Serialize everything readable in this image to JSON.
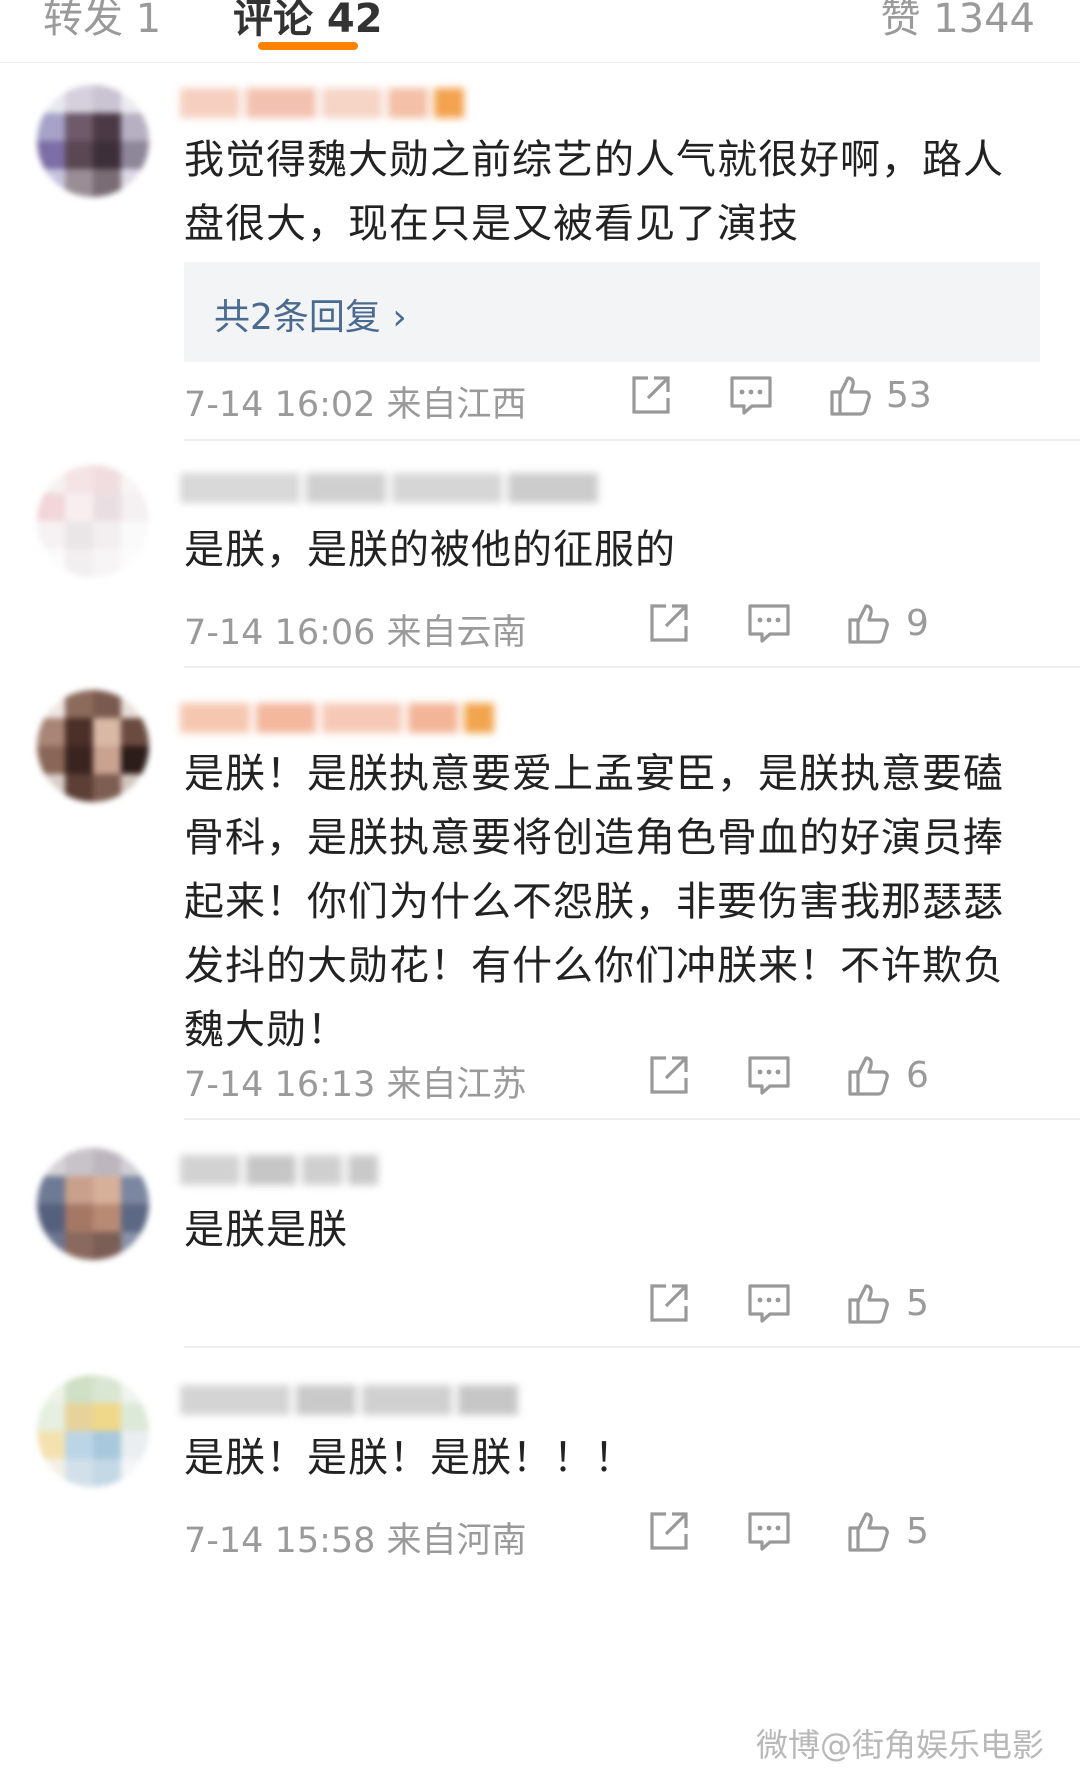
{
  "tabs": {
    "repost": "转发 1",
    "comments": "评论 42",
    "likes": "赞 1344"
  },
  "comments": [
    {
      "text": "我觉得魏大勋之前综艺的人气就很好啊，路人盘很大，现在只是又被看见了演技",
      "reply_label": "共2条回复 ›",
      "meta": "7-14 16:02  来自江西",
      "likes": "53"
    },
    {
      "text": "是朕，是朕的被他的征服的",
      "meta": "7-14 16:06  来自云南",
      "likes": "9"
    },
    {
      "text": "是朕！是朕执意要爱上孟宴臣，是朕执意要磕骨科，是朕执意要将创造角色骨血的好演员捧起来！你们为什么不怨朕，非要伤害我那瑟瑟发抖的大勋花！有什么你们冲朕来！不许欺负魏大勋！",
      "meta": "7-14 16:13  来自江苏",
      "likes": "6"
    },
    {
      "text": "是朕是朕",
      "meta": "",
      "likes": "5"
    },
    {
      "text": "是朕！是朕！是朕！！！",
      "meta": "7-14 15:58  来自河南",
      "likes": "5"
    }
  ],
  "watermark": "微博@街角娱乐电影",
  "colors": {
    "accent": "#ff8200",
    "link": "#4a6a8f",
    "meta": "#9a9a9a"
  },
  "icons": [
    "share-icon",
    "comment-icon",
    "like-icon"
  ]
}
